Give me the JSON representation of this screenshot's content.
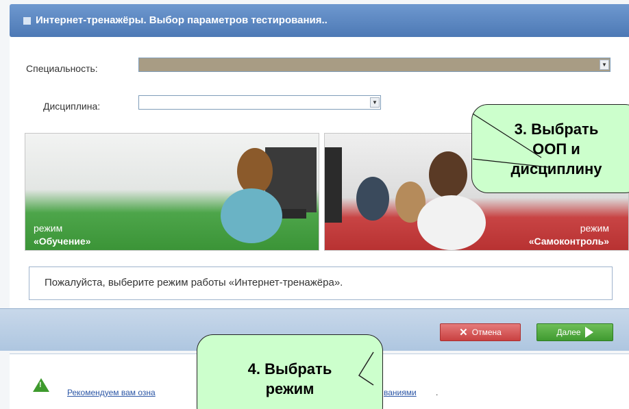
{
  "window": {
    "title": "Интернет-тренажёры. Выбор параметров тестирования.."
  },
  "form": {
    "specialty_label": "Специальность:",
    "specialty_value": "",
    "discipline_label": "Дисциплина:",
    "discipline_value": ""
  },
  "modes": {
    "learning": {
      "small": "режим",
      "big": "«Обучение»"
    },
    "self_control": {
      "small": "режим",
      "big": "«Самоконтроль»"
    }
  },
  "message": "Пожалуйста, выберите режим работы «Интернет-тренажёра».",
  "buttons": {
    "cancel": "Отмена",
    "next": "Далее"
  },
  "recommendation": {
    "link_start": "Рекомендуем вам озна",
    "link_end": "ваниями",
    "tail": "."
  },
  "callouts": {
    "step3": [
      "3. Выбрать",
      "ООП и",
      "дисциплину"
    ],
    "step4": [
      "4. Выбрать",
      "режим"
    ]
  },
  "colors": {
    "titlebar": "#5a85c0",
    "learn_mode": "#4da54a",
    "self_mode": "#c84444",
    "callout_fill": "#ccffcc"
  },
  "icons": {
    "title": "square-icon",
    "dropdown": "chevron-down-icon",
    "cancel": "close-icon",
    "next": "play-icon",
    "recommendation": "warning-triangle-icon"
  }
}
